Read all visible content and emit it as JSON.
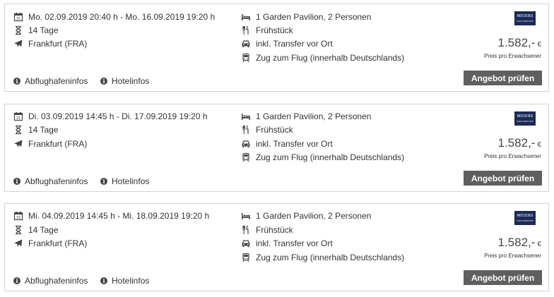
{
  "offers": [
    {
      "dates": "Mo. 02.09.2019 20:40 h - Mo. 16.09.2019 19:20 h",
      "duration": "14 Tage",
      "airport": "Frankfurt (FRA)",
      "room": "1 Garden Pavilion, 2 Personen",
      "board": "Frühstück",
      "transfer": "inkl. Transfer vor Ort",
      "train": "Zug zum Flug (innerhalb Deutschlands)",
      "price": "1.582,-",
      "currency": "€",
      "price_note": "Preis pro Erwachsener",
      "button": "Angebot prüfen",
      "airport_info": "Abflughafeninfos",
      "hotel_info": "Hotelinfos",
      "logo": "MEIERS",
      "logo_sub": "WELTREISEN"
    },
    {
      "dates": "Di. 03.09.2019 14:45 h - Di. 17.09.2019 19:20 h",
      "duration": "14 Tage",
      "airport": "Frankfurt (FRA)",
      "room": "1 Garden Pavilion, 2 Personen",
      "board": "Frühstück",
      "transfer": "inkl. Transfer vor Ort",
      "train": "Zug zum Flug (innerhalb Deutschlands)",
      "price": "1.582,-",
      "currency": "€",
      "price_note": "Preis pro Erwachsener",
      "button": "Angebot prüfen",
      "airport_info": "Abflughafeninfos",
      "hotel_info": "Hotelinfos",
      "logo": "MEIERS",
      "logo_sub": "WELTREISEN"
    },
    {
      "dates": "Mi. 04.09.2019 14:45 h - Mi. 18.09.2019 19:20 h",
      "duration": "14 Tage",
      "airport": "Frankfurt (FRA)",
      "room": "1 Garden Pavilion, 2 Personen",
      "board": "Frühstück",
      "transfer": "inkl. Transfer vor Ort",
      "train": "Zug zum Flug (innerhalb Deutschlands)",
      "price": "1.582,-",
      "currency": "€",
      "price_note": "Preis pro Erwachsener",
      "button": "Angebot prüfen",
      "airport_info": "Abflughafeninfos",
      "hotel_info": "Hotelinfos",
      "logo": "MEIERS",
      "logo_sub": "WELTREISEN"
    }
  ],
  "colors": {
    "button_bg": "#5f5f5f",
    "logo_bg": "#1b2a57",
    "border": "#d4d4d4"
  }
}
